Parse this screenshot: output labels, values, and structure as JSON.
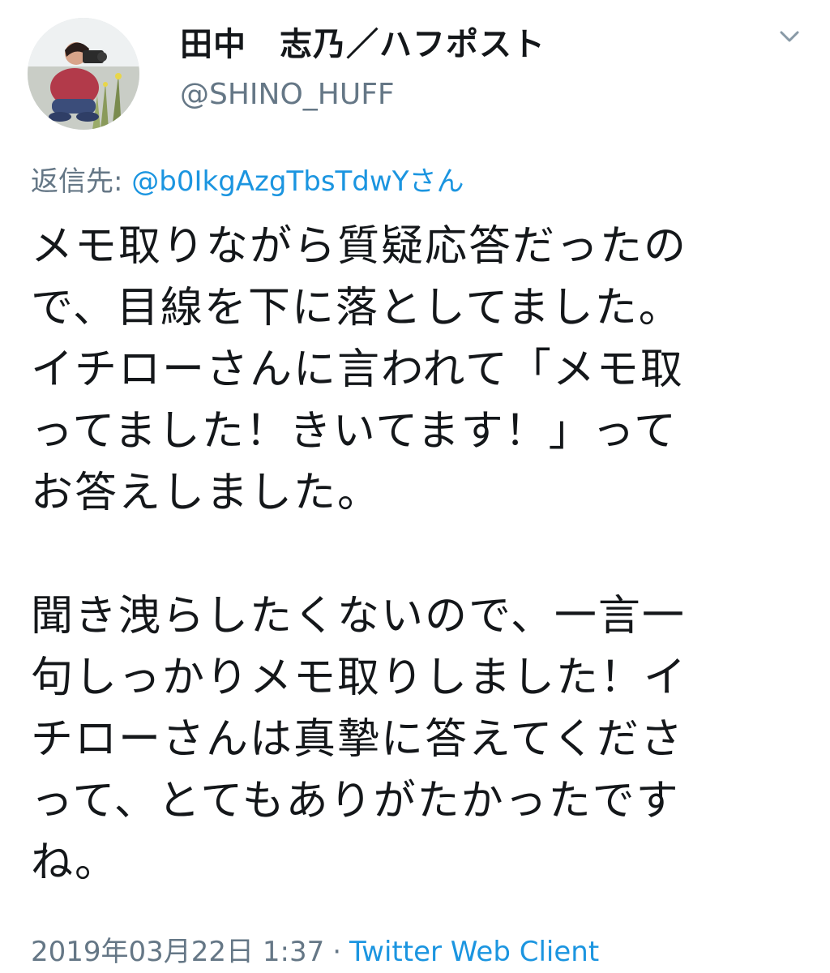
{
  "tweet": {
    "display_name": "田中　志乃／ハフポスト",
    "username": "@SHINO_HUFF",
    "avatar_icon": "user-photo-avatar",
    "caret_icon": "chevron-down-icon",
    "reply": {
      "prefix": "返信先: ",
      "handle": "@b0IkgAzgTbsTdwYさん"
    },
    "paragraph1": [
      "メモ取りながら質疑応答だったの",
      "で、目線を下に落としてました。",
      "イチローさんに言われて「メモ取",
      "ってました！きいてます！」って",
      "お答えしました。"
    ],
    "paragraph2": [
      "聞き洩らしたくないので、一言一",
      "句しっかりメモ取りしました！イ",
      "チローさんは真摯に答えてくださ",
      "って、とてもありがたかったです",
      "ね。"
    ],
    "timestamp": "2019年03月22日 1:37",
    "separator": "·",
    "client": "Twitter Web Client"
  },
  "colors": {
    "text": "#14171a",
    "secondary": "#657786",
    "link": "#1b95e0"
  }
}
